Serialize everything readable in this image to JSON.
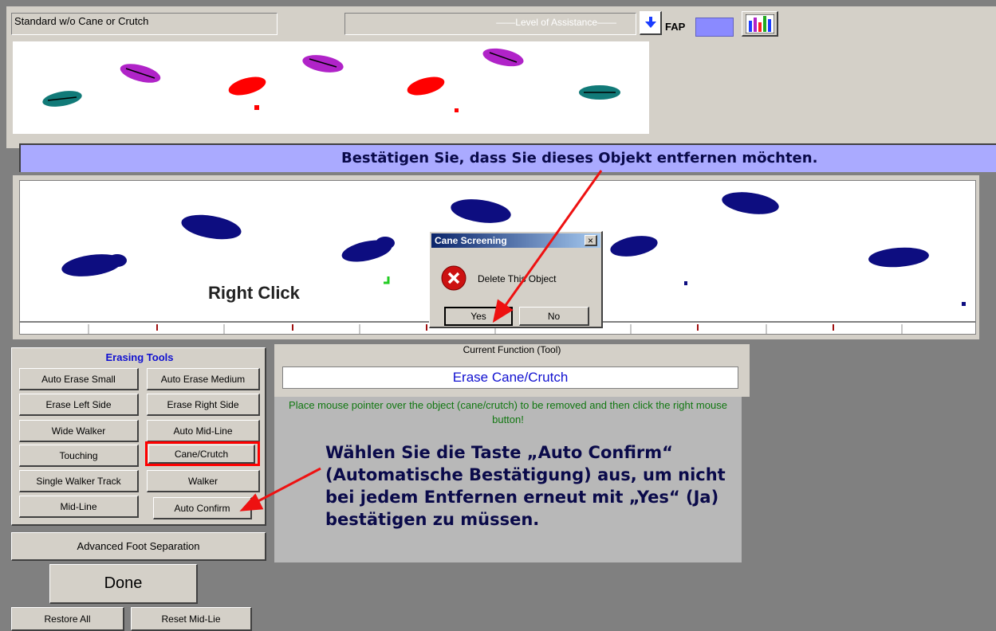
{
  "header": {
    "mode_field": "Standard w/o Cane or Crutch",
    "assist_placeholder": "Level of Assistance",
    "fap_label": "FAP"
  },
  "banner": {
    "text": "Bestätigen Sie, dass Sie dieses Objekt entfernen möchten."
  },
  "canvas": {
    "right_click_label": "Right Click"
  },
  "dialog": {
    "title": "Cane Screening",
    "message": "Delete This Object",
    "yes": "Yes",
    "no": "No",
    "close_glyph": "×"
  },
  "erasing_tools": {
    "title": "Erasing Tools",
    "buttons": {
      "auto_erase_small": "Auto Erase Small",
      "auto_erase_medium": "Auto Erase Medium",
      "erase_left": "Erase Left Side",
      "erase_right": "Erase Right Side",
      "wide_walker": "Wide Walker",
      "auto_mid_line": "Auto Mid-Line",
      "touching": "Touching",
      "cane_crutch": "Cane/Crutch",
      "single_walker": "Single Walker Track",
      "walker": "Walker",
      "mid_line": "Mid-Line",
      "auto_confirm": "Auto Confirm"
    }
  },
  "bottom": {
    "advanced": "Advanced Foot Separation",
    "done": "Done",
    "restore_all": "Restore All",
    "reset_mid_line": "Reset Mid-Lie"
  },
  "current_function": {
    "label": "Current Function (Tool)",
    "value": "Erase Cane/Crutch",
    "instruction": "Place mouse pointer over the object (cane/crutch) to be removed and then click the right mouse button!"
  },
  "annotation": {
    "text": "Wählen Sie die Taste „Auto Confirm“ (Automatische Bestätigung) aus, um nicht bei jedem Entfernen erneut mit „Yes“ (Ja) bestätigen zu müssen."
  },
  "colors": {
    "footprint_dark": "#0d0d80",
    "teal": "#117a78",
    "magenta": "#b023c8",
    "red": "#ff0000",
    "green": "#22cc22",
    "banner_bg": "#aaaaff",
    "fap_box": "#8a8aff",
    "highlight": "#ff0000"
  }
}
